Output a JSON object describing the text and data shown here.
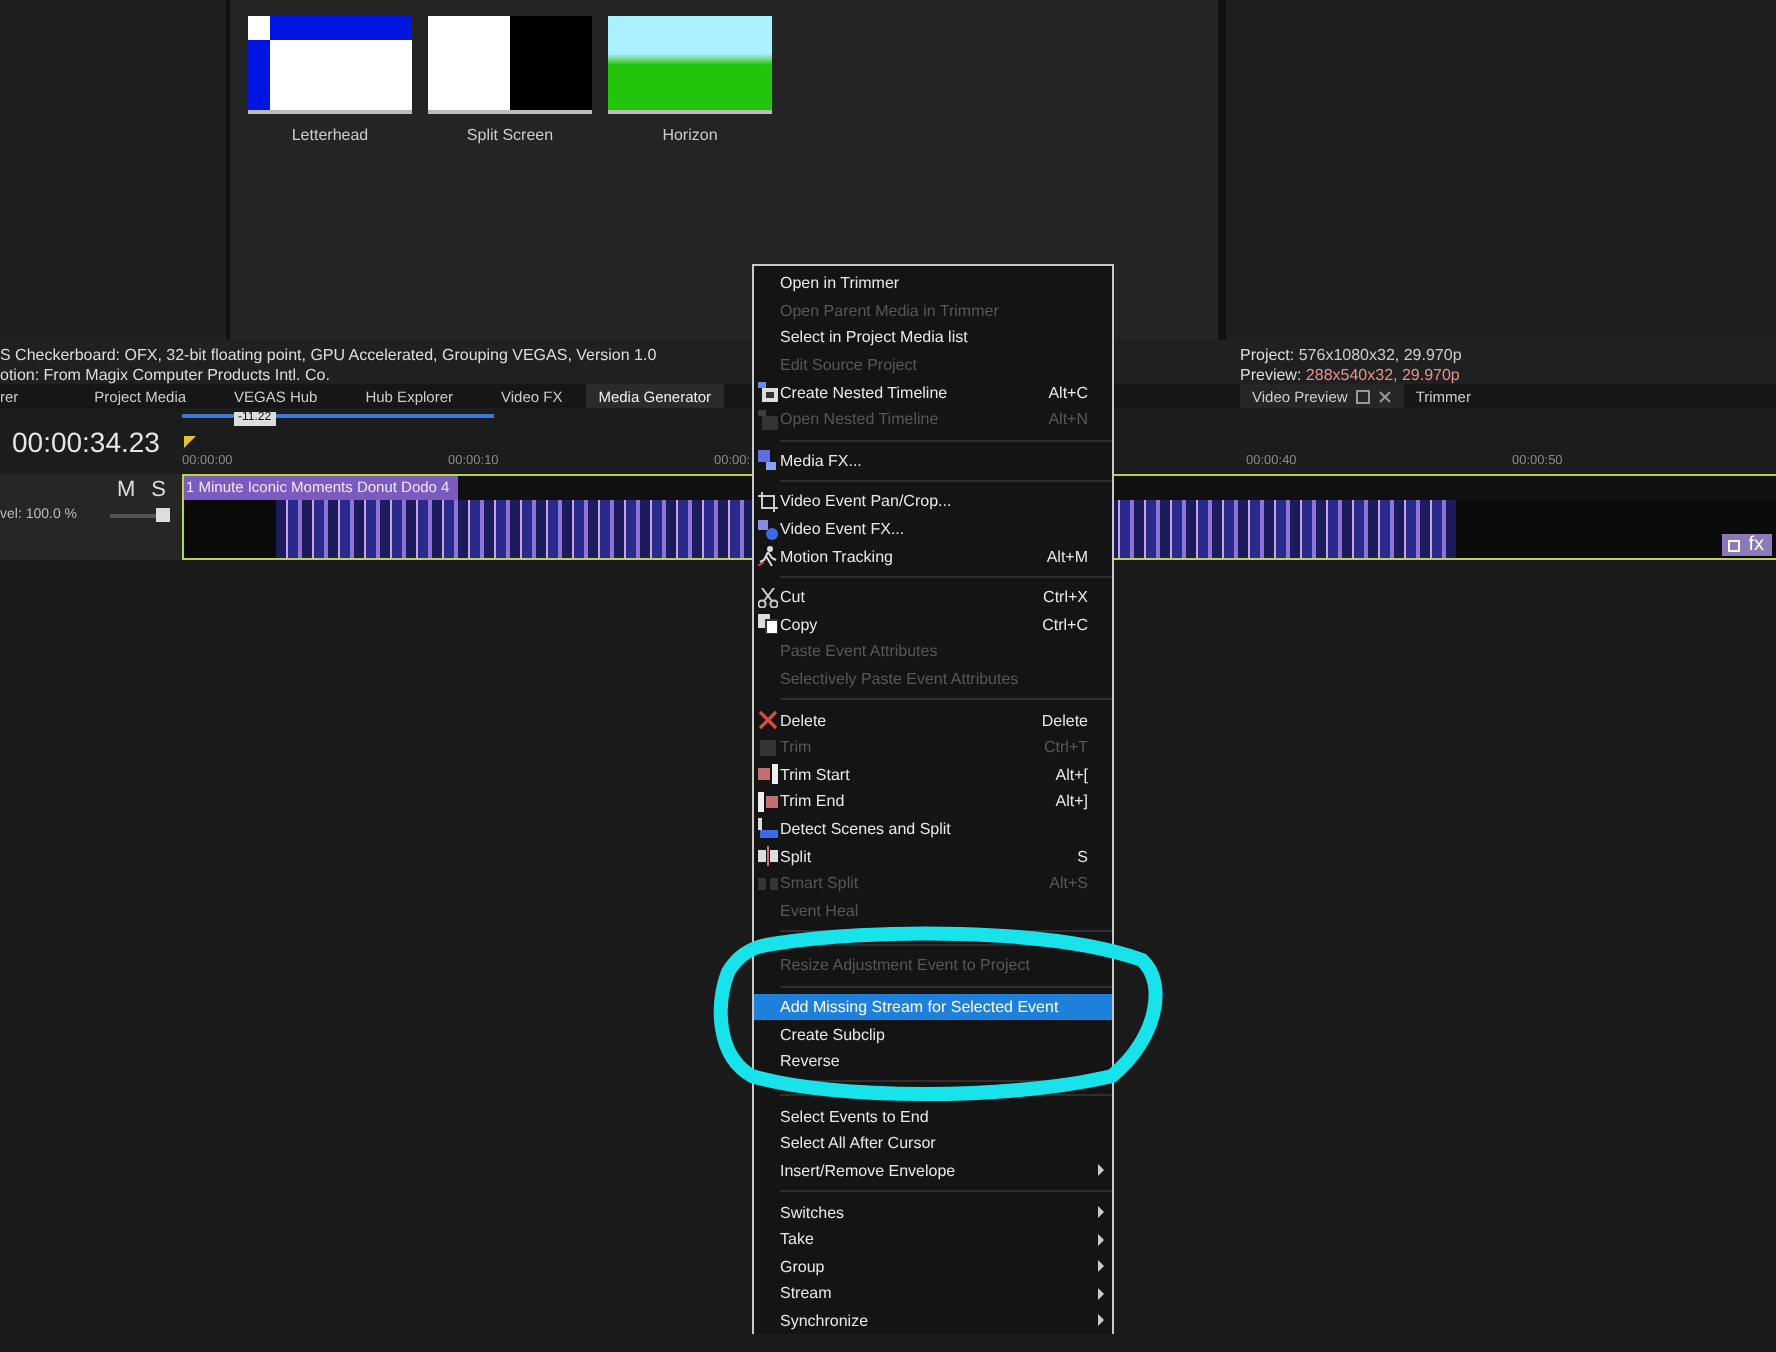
{
  "generator_panel": {
    "presets": [
      "Letterhead",
      "Split Screen",
      "Horizon"
    ]
  },
  "plugin_info": [
    "S Checkerboard: OFX, 32-bit floating point, GPU Accelerated, Grouping VEGAS, Version 1.0",
    "otion: From Magix Computer Products Intl. Co."
  ],
  "preview_info": {
    "project_label": "Project:",
    "project_value": "576x1080x32, 29.970p",
    "preview_label": "Preview:",
    "preview_value": "288x540x32, 29.970p"
  },
  "tabs": [
    {
      "label": "rer",
      "selected": false
    },
    {
      "label": "Project Media",
      "selected": false
    },
    {
      "label": "VEGAS Hub",
      "selected": false
    },
    {
      "label": "Hub Explorer",
      "selected": false
    },
    {
      "label": "Video FX",
      "selected": false
    },
    {
      "label": "Media Generator",
      "selected": true
    }
  ],
  "preview_tabs": [
    {
      "label": "Video Preview",
      "selected": true
    },
    {
      "label": "Trimmer",
      "selected": false
    }
  ],
  "timeline": {
    "time": "00:00:34.23",
    "cursor_label": "-11.22",
    "ruler": [
      "00:00:00",
      "00:00:10",
      "00:00:",
      "00:00:40",
      "00:00:50"
    ],
    "track": {
      "mute": "M",
      "solo": "S",
      "level_text": "vel: 100.0 %",
      "level": 1,
      "clip_title": "1 Minute Iconic Moments Donut Dodo 4",
      "fx": "fx"
    }
  },
  "context_menu": {
    "items": [
      {
        "kind": "item",
        "label": "Open in Trimmer",
        "disabled": false,
        "selected": false,
        "submenu": false
      },
      {
        "kind": "item",
        "label": "Open Parent Media in Trimmer",
        "disabled": true,
        "selected": false,
        "submenu": false
      },
      {
        "kind": "item",
        "label": "Select in Project Media list",
        "disabled": false,
        "selected": false,
        "submenu": false
      },
      {
        "kind": "item",
        "label": "Edit Source Project",
        "disabled": true,
        "selected": false,
        "submenu": false
      },
      {
        "kind": "item",
        "label": "Create Nested Timeline",
        "shortcut": "Alt+C",
        "disabled": false,
        "selected": false,
        "submenu": false
      },
      {
        "kind": "item",
        "label": "Open Nested Timeline",
        "shortcut": "Alt+N",
        "disabled": true,
        "selected": false,
        "submenu": false
      },
      {
        "kind": "separator"
      },
      {
        "kind": "item",
        "label": "Media FX...",
        "disabled": false,
        "selected": false,
        "submenu": false
      },
      {
        "kind": "separator"
      },
      {
        "kind": "item",
        "label": "Video Event Pan/Crop...",
        "disabled": false,
        "selected": false,
        "submenu": false
      },
      {
        "kind": "item",
        "label": "Video Event FX...",
        "disabled": false,
        "selected": false,
        "submenu": false
      },
      {
        "kind": "item",
        "label": "Motion Tracking",
        "shortcut": "Alt+M",
        "disabled": false,
        "selected": false,
        "submenu": false
      },
      {
        "kind": "separator"
      },
      {
        "kind": "item",
        "label": "Cut",
        "shortcut": "Ctrl+X",
        "disabled": false,
        "selected": false,
        "submenu": false
      },
      {
        "kind": "item",
        "label": "Copy",
        "shortcut": "Ctrl+C",
        "disabled": false,
        "selected": false,
        "submenu": false
      },
      {
        "kind": "item",
        "label": "Paste Event Attributes",
        "disabled": true,
        "selected": false,
        "submenu": false
      },
      {
        "kind": "item",
        "label": "Selectively Paste Event Attributes",
        "disabled": true,
        "selected": false,
        "submenu": false
      },
      {
        "kind": "separator"
      },
      {
        "kind": "item",
        "label": "Delete",
        "shortcut": "Delete",
        "disabled": false,
        "selected": false,
        "submenu": false
      },
      {
        "kind": "item",
        "label": "Trim",
        "shortcut": "Ctrl+T",
        "disabled": true,
        "selected": false,
        "submenu": false
      },
      {
        "kind": "item",
        "label": "Trim Start",
        "shortcut": "Alt+[",
        "disabled": false,
        "selected": false,
        "submenu": false
      },
      {
        "kind": "item",
        "label": "Trim End",
        "shortcut": "Alt+]",
        "disabled": false,
        "selected": false,
        "submenu": false
      },
      {
        "kind": "item",
        "label": "Detect Scenes and Split",
        "disabled": false,
        "selected": false,
        "submenu": false
      },
      {
        "kind": "item",
        "label": "Split",
        "shortcut": "S",
        "disabled": false,
        "selected": false,
        "submenu": false
      },
      {
        "kind": "item",
        "label": "Smart Split",
        "shortcut": "Alt+S",
        "disabled": true,
        "selected": false,
        "submenu": false
      },
      {
        "kind": "item",
        "label": "Event Heal",
        "disabled": true,
        "selected": false,
        "submenu": false
      },
      {
        "kind": "separator"
      },
      {
        "kind": "separator"
      },
      {
        "kind": "item",
        "label": "Resize Adjustment Event to Project",
        "disabled": true,
        "selected": false,
        "submenu": false
      },
      {
        "kind": "separator"
      },
      {
        "kind": "item",
        "label": "Add Missing Stream for Selected Event",
        "disabled": false,
        "selected": true,
        "submenu": false
      },
      {
        "kind": "item",
        "label": "Create Subclip",
        "disabled": false,
        "selected": false,
        "submenu": false
      },
      {
        "kind": "item",
        "label": "Reverse",
        "disabled": false,
        "selected": false,
        "submenu": false
      },
      {
        "kind": "separator"
      },
      {
        "kind": "separator"
      },
      {
        "kind": "item",
        "label": "Select Events to End",
        "disabled": false,
        "selected": false,
        "submenu": false
      },
      {
        "kind": "item",
        "label": "Select All After Cursor",
        "disabled": false,
        "selected": false,
        "submenu": false
      },
      {
        "kind": "item",
        "label": "Insert/Remove Envelope",
        "disabled": false,
        "selected": false,
        "submenu": true
      },
      {
        "kind": "separator"
      },
      {
        "kind": "item",
        "label": "Switches",
        "disabled": false,
        "selected": false,
        "submenu": true
      },
      {
        "kind": "item",
        "label": "Take",
        "disabled": false,
        "selected": false,
        "submenu": true
      },
      {
        "kind": "item",
        "label": "Group",
        "disabled": false,
        "selected": false,
        "submenu": true
      },
      {
        "kind": "item",
        "label": "Stream",
        "disabled": false,
        "selected": false,
        "submenu": true
      },
      {
        "kind": "item",
        "label": "Synchronize",
        "disabled": false,
        "selected": false,
        "submenu": true
      }
    ]
  }
}
